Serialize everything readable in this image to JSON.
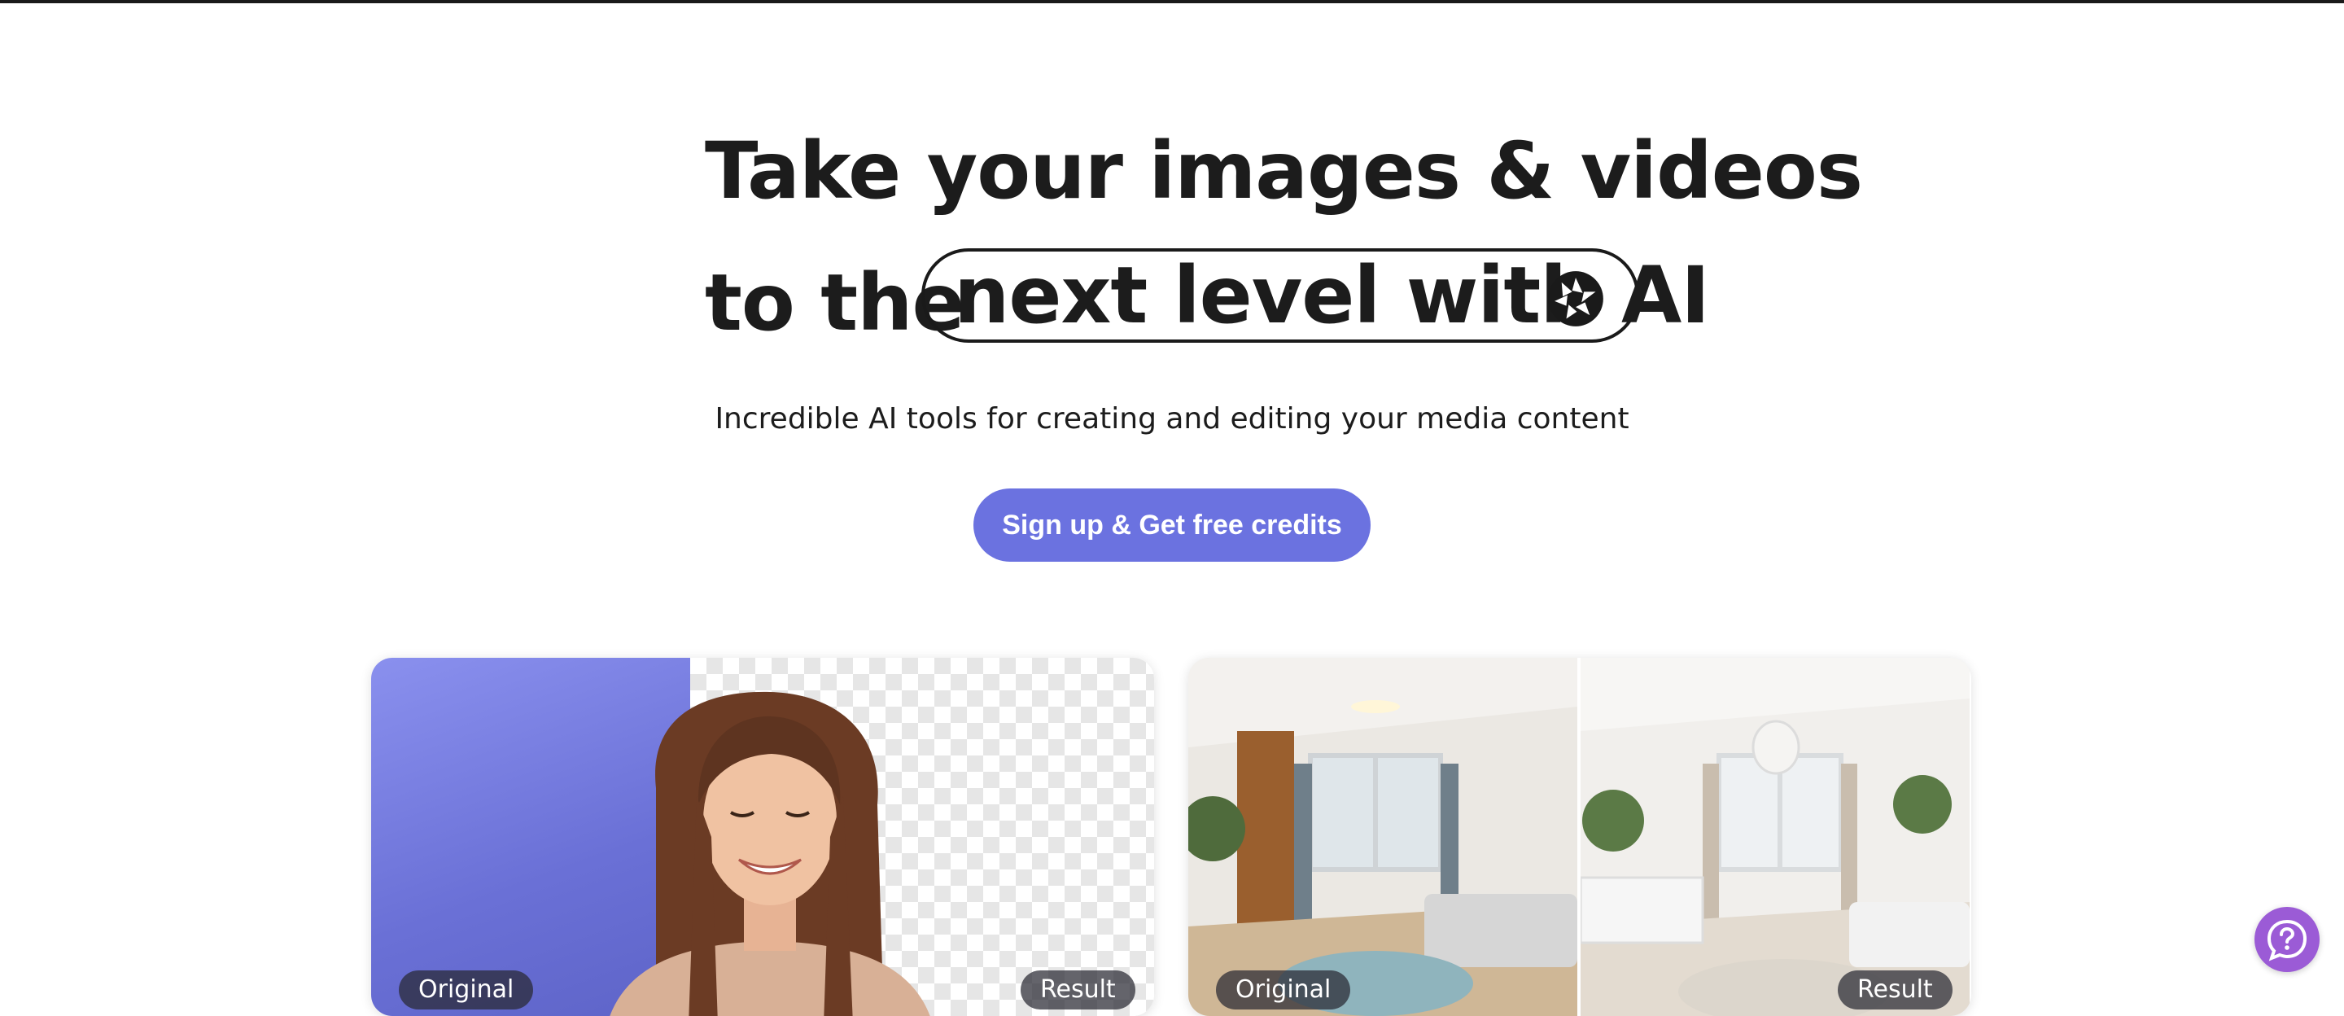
{
  "hero": {
    "headline_line1": "Take your images & videos",
    "headline_line2_prefix": "to the",
    "headline_highlight": "next level with AI",
    "subtitle": "Incredible AI tools for creating and editing your media content",
    "cta_label": "Sign up & Get free credits"
  },
  "cards": [
    {
      "label_left": "Original",
      "label_right": "Result"
    },
    {
      "label_left": "Original",
      "label_right": "Result"
    }
  ],
  "icons": {
    "highlight_icon": "aperture-icon",
    "help_icon": "help-chat-icon"
  },
  "colors": {
    "cta": "#6b72e0",
    "help_button": "#9b5bd6",
    "text": "#1c1c1c"
  }
}
